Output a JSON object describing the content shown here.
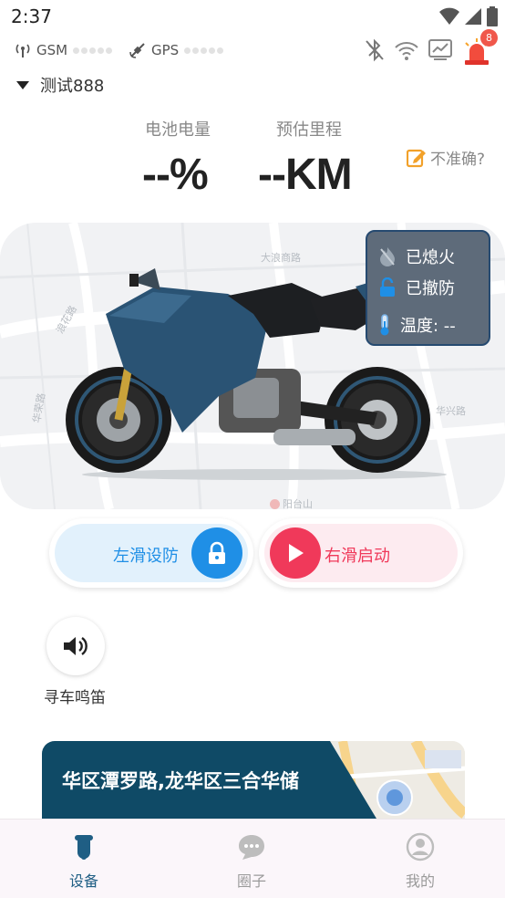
{
  "status_bar": {
    "time": "2:37"
  },
  "device_row": {
    "gsm_label": "GSM",
    "gps_label": "GPS",
    "alert_count": "8"
  },
  "device_selector": {
    "name": "测试888"
  },
  "stats": {
    "battery_label": "电池电量",
    "battery_value": "--%",
    "range_label": "预估里程",
    "range_value": "--KM",
    "not_accurate_label": "不准确?"
  },
  "map_labels": [
    "大浪商路",
    "大浪",
    "浪花路",
    "华荣路",
    "华兴路",
    "阳台山"
  ],
  "info_panel": {
    "ignition": "已熄火",
    "disarm": "已撤防",
    "temperature": "温度: --"
  },
  "controls": {
    "arm_label": "左滑设防",
    "start_label": "右滑启动",
    "honk_label": "寻车鸣笛"
  },
  "address": {
    "text": "华区潭罗路,龙华区三合华储"
  },
  "bottom_nav": {
    "items": [
      {
        "label": "设备",
        "active": true
      },
      {
        "label": "圈子",
        "active": false
      },
      {
        "label": "我的",
        "active": false
      }
    ]
  },
  "colors": {
    "accent_blue": "#1f8fe6",
    "accent_red": "#f0395a",
    "nav_active": "#1f5e84",
    "alert_red": "#f24c3d"
  }
}
